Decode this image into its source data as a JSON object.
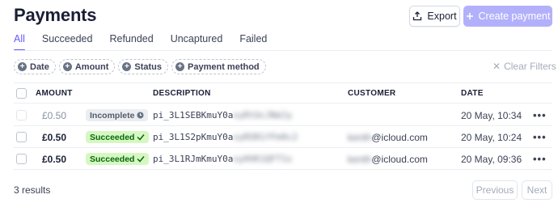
{
  "header": {
    "title": "Payments",
    "export_label": "Export",
    "create_label": "Create payment"
  },
  "tabs": [
    {
      "label": "All",
      "active": true
    },
    {
      "label": "Succeeded",
      "active": false
    },
    {
      "label": "Refunded",
      "active": false
    },
    {
      "label": "Uncaptured",
      "active": false
    },
    {
      "label": "Failed",
      "active": false
    }
  ],
  "filters": {
    "chips": [
      "Date",
      "Amount",
      "Status",
      "Payment method"
    ],
    "clear_label": "Clear Filters"
  },
  "table": {
    "columns": {
      "amount": "AMOUNT",
      "description": "DESCRIPTION",
      "customer": "CUSTOMER",
      "date": "DATE"
    },
    "rows": [
      {
        "amount": "£0.50",
        "status": "Incomplete",
        "desc_prefix": "pi_3L1SEBKmuY0a",
        "desc_hidden": "xyRtUcJNdJy",
        "customer_hidden": "",
        "customer_domain": "",
        "date": "20 May, 10:34"
      },
      {
        "amount": "£0.50",
        "status": "Succeeded",
        "desc_prefix": "pi_3L1S2pKmuY0a",
        "desc_hidden": "xyRSR1fFm9c2",
        "customer_hidden": "kenth",
        "customer_domain": "@icloud.com",
        "date": "20 May, 10:24"
      },
      {
        "amount": "£0.50",
        "status": "Succeeded",
        "desc_prefix": "pi_3L1RJmKmuY0a",
        "desc_hidden": "xyHVK1QFT1x",
        "customer_hidden": "kenth",
        "customer_domain": "@icloud.com",
        "date": "20 May, 09:36"
      }
    ]
  },
  "footer": {
    "results": "3 results",
    "previous_label": "Previous",
    "next_label": "Next"
  },
  "colors": {
    "accent": "#635bff",
    "succeeded_bg": "#d7f7c2",
    "succeeded_text": "#05690d",
    "incomplete_bg": "#ebeef1"
  },
  "icons": [
    "export-icon",
    "plus-icon",
    "add-filter-icon",
    "close-icon",
    "clock-icon",
    "check-icon",
    "more-icon"
  ]
}
